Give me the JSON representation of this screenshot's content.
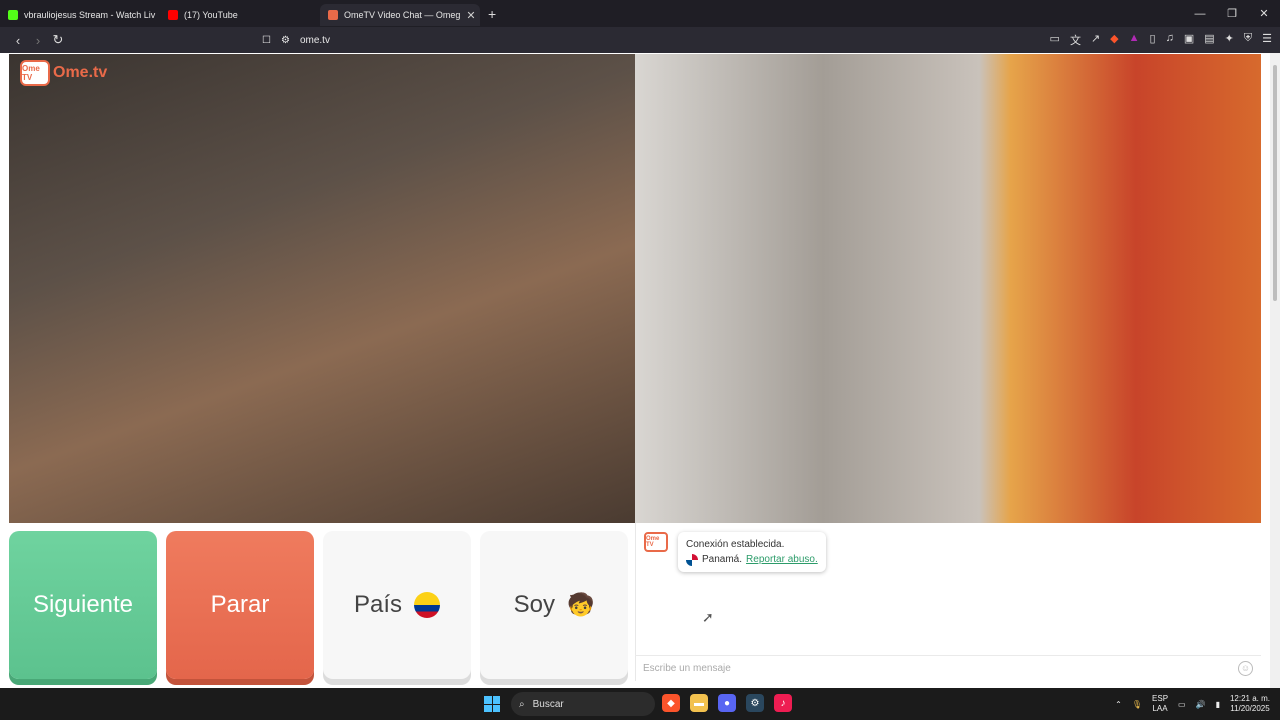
{
  "browser": {
    "tabs": [
      {
        "title": "vbrauliojesus Stream - Watch Liv",
        "favicon": "kick-icon",
        "color": "#53fc18"
      },
      {
        "title": "(17) YouTube",
        "favicon": "youtube-icon",
        "color": "#ff0000"
      },
      {
        "title": "OmeTV Video Chat — Omeg",
        "favicon": "ometv-icon",
        "color": "#e96a49"
      }
    ],
    "url": "ome.tv"
  },
  "site": {
    "logo_text": "Ome.tv",
    "logo_box": "Ome TV"
  },
  "controls": {
    "next_label": "Siguiente",
    "stop_label": "Parar",
    "country_label": "País",
    "country_flag": "colombia-flag-icon",
    "gender_label": "Soy",
    "gender_icon": "boy-face-icon",
    "gender_emoji": "🧒"
  },
  "chat": {
    "status": "Conexión establecida.",
    "country": "Panamá.",
    "report_link": "Reportar abuso.",
    "message_placeholder": "Escribe un mensaje",
    "avatar_text": "Ome TV"
  },
  "taskbar": {
    "search_label": "Buscar",
    "lang_top": "ESP",
    "lang_bottom": "LAA",
    "time": "12:21 a. m.",
    "date": "11/20/2025"
  },
  "colors": {
    "next": "#5cc28e",
    "stop": "#e4664b",
    "brand": "#e96a49"
  }
}
